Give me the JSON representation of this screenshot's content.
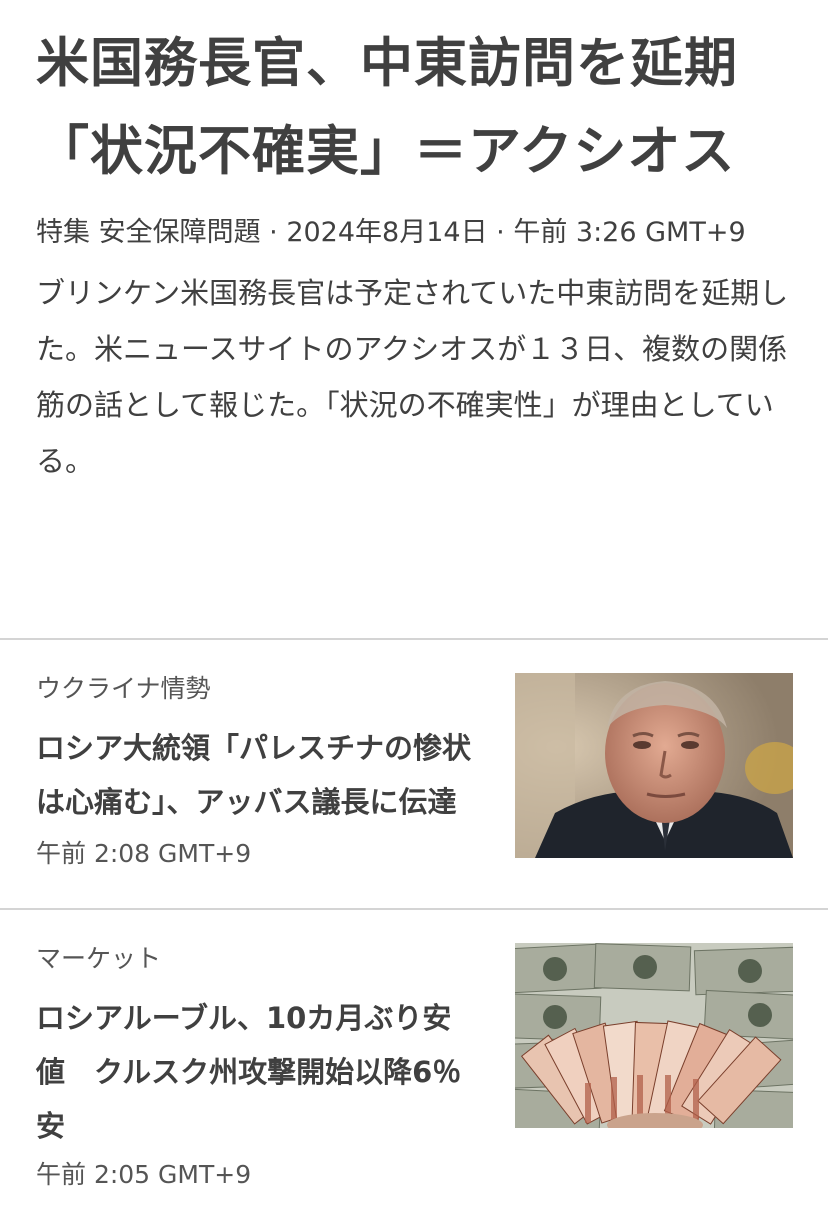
{
  "lead": {
    "title": "米国務長官、中東訪問を延期　「状況不確実」＝アクシオス",
    "meta": "特集 安全保障問題 · 2024年8月14日 · 午前 3:26 GMT+9",
    "summary": "ブリンケン米国務長官は予定されていた中東訪問を延期した。米ニュースサイトのアクシオスが１３日、複数の関係筋の話として報じた。「状況の不確実性」が理由としている。"
  },
  "stories": [
    {
      "kicker": "ウクライナ情勢",
      "title": "ロシア大統領「パレスチナの惨状は心痛む」、アッバス議長に伝達",
      "time": "午前 2:08 GMT+9"
    },
    {
      "kicker": "マーケット",
      "title": "ロシアルーブル、10カ月ぶり安値　クルスク州攻撃開始以降6％安",
      "time": "午前 2:05 GMT+9"
    }
  ]
}
